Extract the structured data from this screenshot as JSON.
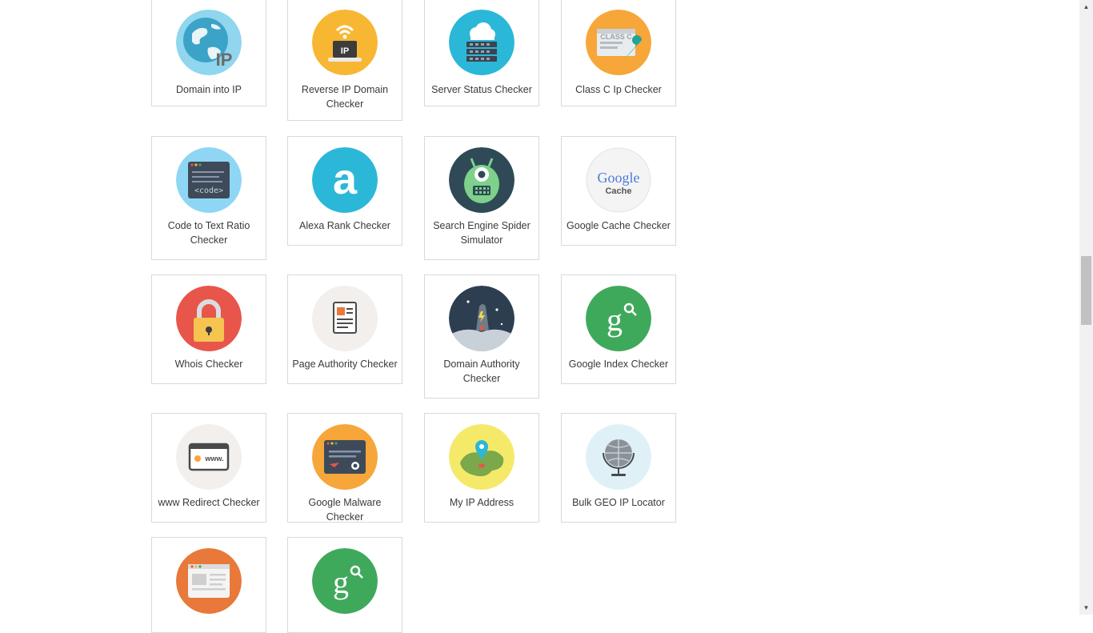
{
  "tools": [
    {
      "label": "Domain into IP",
      "icon": "globe-ip-icon"
    },
    {
      "label": "Reverse IP Domain Checker",
      "icon": "laptop-ip-icon"
    },
    {
      "label": "Server Status Checker",
      "icon": "cloud-server-icon"
    },
    {
      "label": "Class C Ip Checker",
      "icon": "class-c-wrench-icon"
    },
    {
      "label": "Code to Text Ratio Checker",
      "icon": "code-window-icon"
    },
    {
      "label": "Alexa Rank Checker",
      "icon": "alexa-logo-icon"
    },
    {
      "label": "Search Engine Spider Simulator",
      "icon": "spider-robot-icon"
    },
    {
      "label": "Google Cache Checker",
      "icon": "google-cache-icon"
    },
    {
      "label": "Whois Checker",
      "icon": "padlock-icon"
    },
    {
      "label": "Page Authority Checker",
      "icon": "document-icon"
    },
    {
      "label": "Domain Authority Checker",
      "icon": "rocket-icon"
    },
    {
      "label": "Google Index Checker",
      "icon": "google-search-icon"
    },
    {
      "label": "www Redirect Checker",
      "icon": "www-browser-icon"
    },
    {
      "label": "Google Malware Checker",
      "icon": "malware-browser-icon"
    },
    {
      "label": "My IP Address",
      "icon": "map-pin-icon"
    },
    {
      "label": "Bulk GEO IP Locator",
      "icon": "globe-stand-icon"
    },
    {
      "label": "",
      "icon": "browser-page-icon"
    },
    {
      "label": "",
      "icon": "google-search-icon"
    }
  ],
  "icons": {
    "class_c": "CLASS C",
    "ip": "IP",
    "code": "<code>",
    "alexa": "a",
    "google": "Google",
    "cache": "Cache",
    "g_letter": "g",
    "www": "www."
  },
  "colors": {
    "tile_border": "#d9d9d9",
    "label_text": "#3a3a3a",
    "blue": "#2bb8d8",
    "yellow": "#f7b733",
    "green": "#3fa95b",
    "red": "#e8554a",
    "orange": "#e8793a"
  }
}
